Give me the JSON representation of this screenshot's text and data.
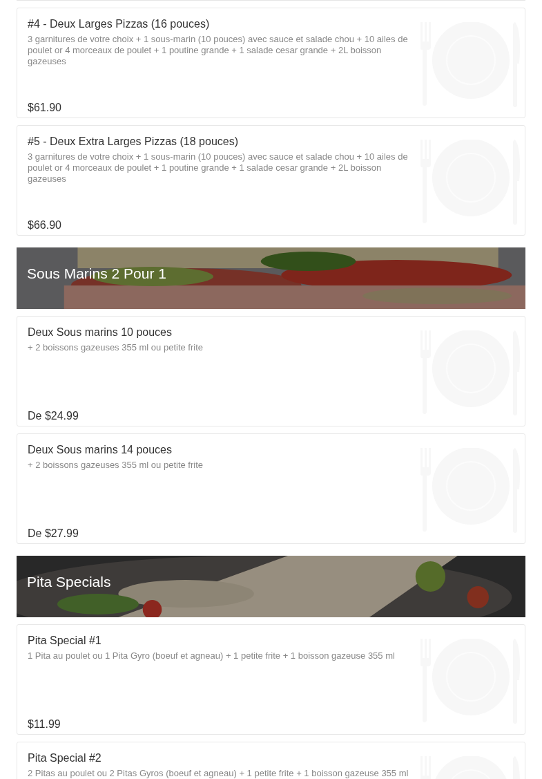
{
  "menu": [
    {
      "kind": "item",
      "name": "#4 - Deux Larges Pizzas (16 pouces)",
      "description": "3 garnitures de votre choix + 1 sous-marin (10 pouces) avec sauce et salade chou + 10 ailes de poulet or 4 morceaux de poulet + 1 poutine grande + 1 salade cesar grande + 2L boisson gazeuses",
      "price": "$61.90"
    },
    {
      "kind": "item",
      "name": "#5 - Deux Extra Larges Pizzas (18 pouces)",
      "description": "3 garnitures de votre choix + 1 sous-marin (10 pouces) avec sauce et salade chou + 10 ailes de poulet or 4 morceaux de poulet + 1 poutine grande + 1 salade cesar grande + 2L boisson gazeuses",
      "price": "$66.90"
    },
    {
      "kind": "banner",
      "title": "Sous Marins 2 Pour 1"
    },
    {
      "kind": "item",
      "name": "Deux Sous marins 10 pouces",
      "description": "+ 2 boissons gazeuses 355 ml ou petite frite",
      "price": "De $24.99"
    },
    {
      "kind": "item",
      "name": "Deux Sous marins 14 pouces",
      "description": "+ 2 boissons gazeuses 355 ml ou petite frite",
      "price": "De $27.99"
    },
    {
      "kind": "banner",
      "title": "Pita Specials"
    },
    {
      "kind": "item",
      "name": "Pita Special #1",
      "description": "1 Pita au poulet ou 1 Pita Gyro (boeuf et agneau) + 1 petite frite + 1 boisson gazeuse 355 ml",
      "price": "$11.99"
    },
    {
      "kind": "item",
      "name": "Pita Special #2",
      "description": "2 Pitas au poulet ou 2 Pitas Gyros (boeuf et agneau) + 1 petite frite + 1 boisson gazeuse 355 ml"
    }
  ]
}
